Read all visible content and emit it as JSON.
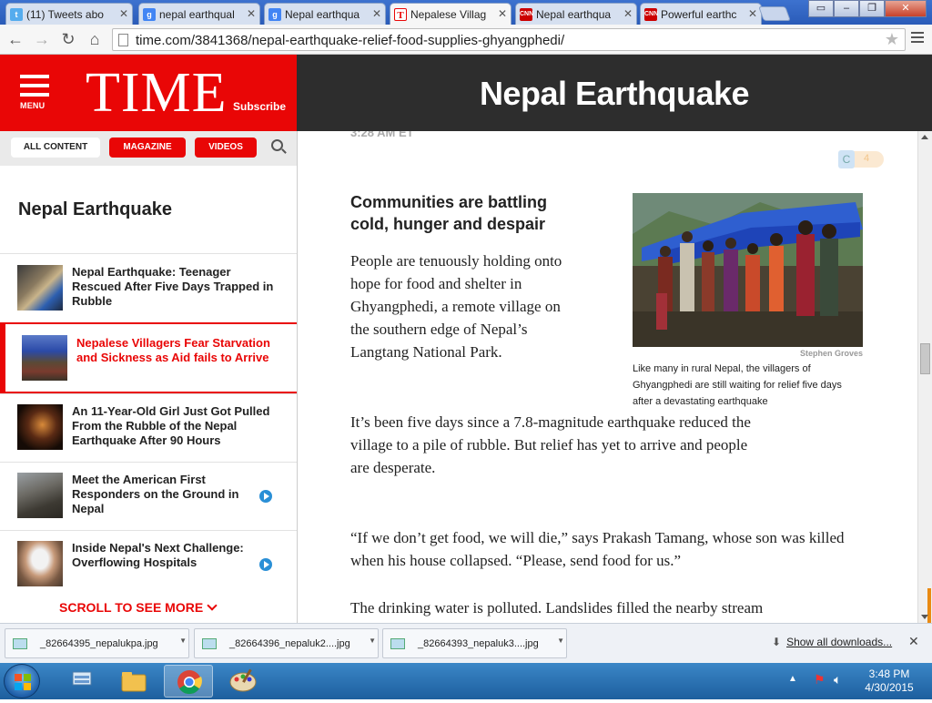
{
  "browser": {
    "tabs": [
      {
        "title": "(11) Tweets abo",
        "favicon": "twitter-icon",
        "color": "#55acee"
      },
      {
        "title": "nepal earthqual",
        "favicon": "google-icon",
        "color": "#4285f4"
      },
      {
        "title": "Nepal earthqua",
        "favicon": "google-images-icon",
        "color": "#4285f4"
      },
      {
        "title": "Nepalese Villag",
        "favicon": "time-icon",
        "color": "#e90606",
        "active": true
      },
      {
        "title": "Nepal earthqua",
        "favicon": "cnn-icon",
        "color": "#cc0000"
      },
      {
        "title": "Powerful earthc",
        "favicon": "cnn-icon",
        "color": "#cc0000"
      }
    ],
    "url": "time.com/3841368/nepal-earthquake-relief-food-supplies-ghyangphedi/"
  },
  "header": {
    "menu_label": "MENU",
    "logo": "TIME",
    "subscribe": "Subscribe",
    "page_title": "Nepal Earthquake",
    "brand_color": "#e90606"
  },
  "sidebar": {
    "filters": {
      "all": "ALL CONTENT",
      "magazine": "MAGAZINE",
      "videos": "VIDEOS"
    },
    "title": "Nepal Earthquake",
    "items": [
      {
        "label": "Nepal Earthquake: Teenager Rescued After Five Days Trapped in Rubble",
        "video": false,
        "active": false
      },
      {
        "label": "Nepalese Villagers Fear Starvation and Sickness as Aid fails to Arrive",
        "video": false,
        "active": true
      },
      {
        "label": "An 11-Year-Old Girl Just Got Pulled From the Rubble of the Nepal Earthquake After 90 Hours",
        "video": false,
        "active": false
      },
      {
        "label": "Meet the American First Responders on the Ground in Nepal",
        "video": true,
        "active": false
      },
      {
        "label": "Inside Nepal's Next Challenge: Overflowing Hospitals",
        "video": true,
        "active": false
      }
    ],
    "scroll_more": "SCROLL TO SEE MORE"
  },
  "article": {
    "timestamp": "3:28 AM ET",
    "share_count": "4",
    "subhead": "Communities are battling cold, hunger and despair",
    "paragraphs": [
      "People are tenuously holding onto hope for food and shelter in Ghyangphedi, a remote village on the southern edge of Nepal’s Langtang National Park.",
      "It’s been five days since a 7.8-magnitude earthquake reduced the village to a pile of rubble. But relief has yet to arrive and people are desperate.",
      "“If we don’t get food, we will die,” says Prakash Tamang, whose son was killed when his house collapsed. “Please, send food for us.”",
      "The drinking water is polluted. Landslides filled the nearby stream"
    ],
    "photo_credit": "Stephen Groves",
    "caption": "Like many in rural Nepal, the villagers of Ghyangphedi are still waiting for relief five days after a devastating earthquake"
  },
  "downloads": {
    "files": [
      "_82664395_nepalukpa.jpg",
      "_82664396_nepaluk2....jpg",
      "_82664393_nepaluk3....jpg"
    ],
    "show_all": "Show all downloads..."
  },
  "taskbar": {
    "time": "3:48 PM",
    "date": "4/30/2015"
  }
}
